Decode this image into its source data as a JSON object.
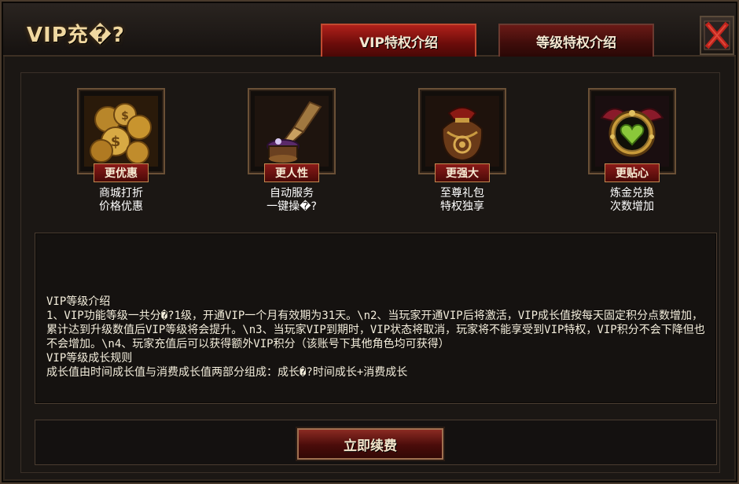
{
  "window": {
    "title": "VIP充�?",
    "close_icon": "close-x-icon"
  },
  "tabs": [
    {
      "label": "VIP特权介绍",
      "active": true
    },
    {
      "label": "等级特权介绍",
      "active": false
    }
  ],
  "features": [
    {
      "icon": "gold-coins-icon",
      "tag": "更优惠",
      "desc_line1": "商城打折",
      "desc_line2": "价格优惠"
    },
    {
      "icon": "auto-lamp-icon",
      "tag": "更人性",
      "desc_line1": "自动服务",
      "desc_line2": "一键操�?"
    },
    {
      "icon": "gift-bag-icon",
      "tag": "更强大",
      "desc_line1": "至尊礼包",
      "desc_line2": "特权独享"
    },
    {
      "icon": "heart-amulet-icon",
      "tag": "更贴心",
      "desc_line1": "炼金兑换",
      "desc_line2": "次数增加"
    }
  ],
  "info": {
    "text": "VIP等级介绍\n1、VIP功能等级一共分�?1级，开通VIP一个月有效期为31天。\\n2、当玩家开通VIP后将激活，VIP成长值按每天固定积分点数增加，累计达到升级数值后VIP等级将会提升。\\n3、当玩家VIP到期时，VIP状态将取消，玩家将不能享受到VIP特权，VIP积分不会下降但也不会增加。\\n4、玩家充值后可以获得额外VIP积分（该账号下其他角色均可获得）\nVIP等级成长规则\n成长值由时间成长值与消费成长值两部分组成：成长�?时间成长+消费成长"
  },
  "actions": {
    "renew_label": "立即续费"
  },
  "colors": {
    "accent_red": "#8a1a18",
    "gold_text": "#f0d8a0",
    "panel_bg": "#151210"
  }
}
